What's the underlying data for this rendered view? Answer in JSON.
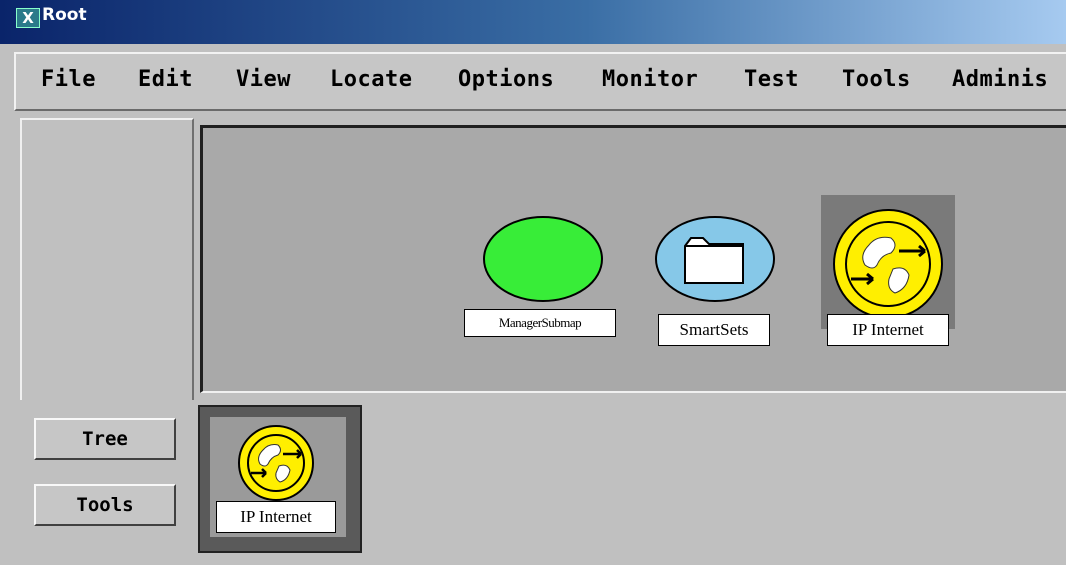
{
  "window": {
    "title": "Root",
    "x_icon": "X"
  },
  "menu": [
    {
      "label": "File"
    },
    {
      "label": "Edit"
    },
    {
      "label": "View"
    },
    {
      "label": "Locate"
    },
    {
      "label": "Options"
    },
    {
      "label": "Monitor"
    },
    {
      "label": "Test"
    },
    {
      "label": "Tools"
    },
    {
      "label": "Adminis"
    }
  ],
  "map": {
    "symbols": [
      {
        "label": "ManagerSubmap",
        "icon": "green-ellipse-icon"
      },
      {
        "label": "SmartSets",
        "icon": "folder-icon"
      },
      {
        "label": "IP Internet",
        "icon": "globe-icon"
      }
    ]
  },
  "bottom": {
    "buttons": {
      "tree": "Tree",
      "tools": "Tools"
    },
    "tree_item": {
      "label": "IP Internet",
      "icon": "globe-icon"
    }
  },
  "colors": {
    "manager_submap": "#38ed38",
    "smartsets": "#86c8e8",
    "internet": "#ffef00"
  }
}
